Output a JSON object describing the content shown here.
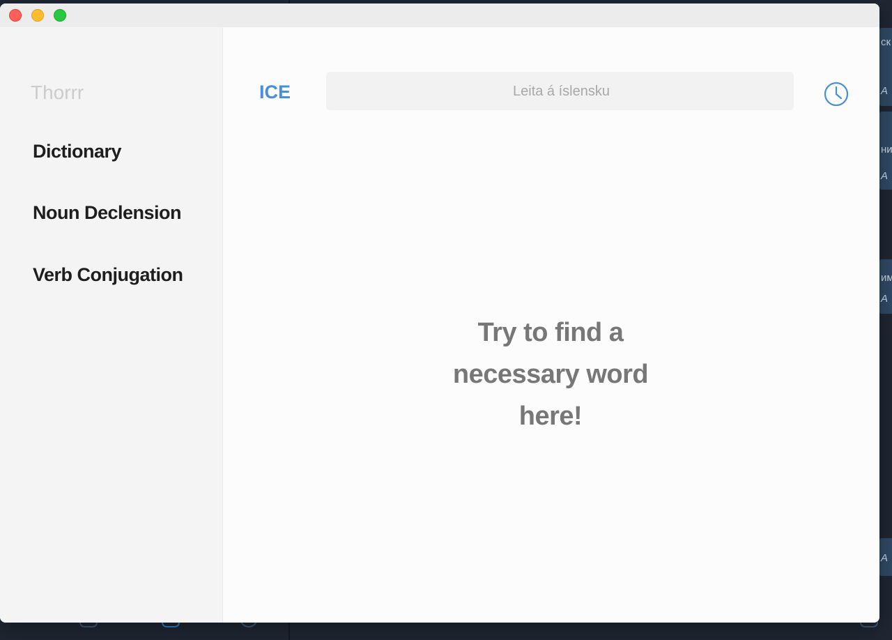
{
  "window": {
    "controls": [
      "close",
      "minimize",
      "maximize"
    ]
  },
  "sidebar": {
    "brand": "Thorrr",
    "items": [
      {
        "label": "Dictionary"
      },
      {
        "label": "Noun Declension"
      },
      {
        "label": "Verb Conjugation"
      }
    ]
  },
  "main": {
    "language": "ICE",
    "search": {
      "placeholder": "Leita á íslensku",
      "value": ""
    },
    "history_icon": "clock-icon",
    "empty_state": {
      "lines": [
        "Try to find a",
        "necessary word",
        "here!"
      ]
    }
  },
  "background": {
    "right_texts": [
      "ск",
      "А",
      "ни",
      "А",
      "им",
      "А",
      "А"
    ]
  },
  "colors": {
    "accent": "#4a8fd6",
    "close": "#fe5f57",
    "minimize": "#febc2e",
    "maximize": "#28c840"
  }
}
